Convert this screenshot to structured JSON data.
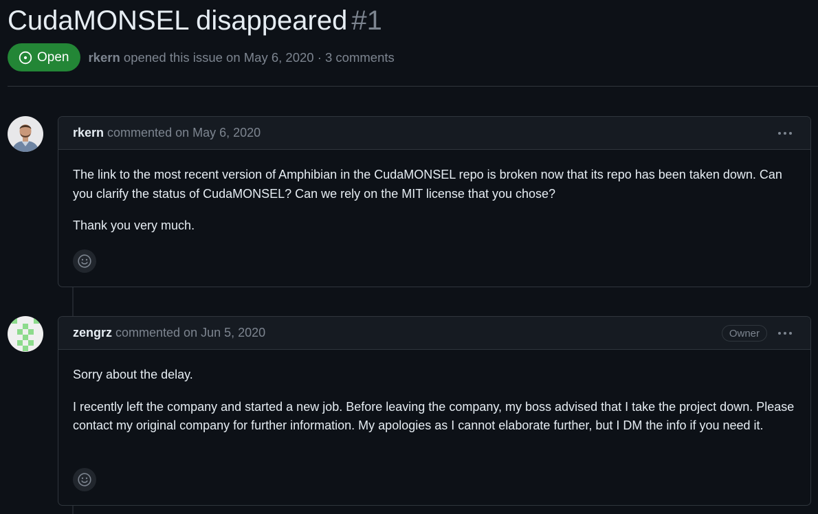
{
  "issue": {
    "title": "CudaMONSEL disappeared",
    "number": "#1",
    "state": "Open",
    "author": "rkern",
    "meta": "opened this issue on May 6, 2020 · 3 comments"
  },
  "comments": [
    {
      "author": "rkern",
      "date": "commented on May 6, 2020",
      "paragraphs": [
        "The link to the most recent version of Amphibian in the CudaMONSEL repo is broken now that its repo has been taken down. Can you clarify the status of CudaMONSEL? Can we rely on the MIT license that you chose?",
        "Thank you very much."
      ]
    },
    {
      "author": "zengrz",
      "date": "commented on Jun 5, 2020",
      "badge": "Owner",
      "paragraphs": [
        "Sorry about the delay.",
        "I recently left the company and started a new job. Before leaving the company, my boss advised that I take the project down. Please contact my original company for further information. My apologies as I cannot elaborate further, but I DM the info if you need it."
      ]
    }
  ],
  "icons": {
    "state": "issue-opened-icon",
    "menu": "kebab-horizontal-icon",
    "reaction": "smiley-icon"
  },
  "colors": {
    "background": "#0d1117",
    "open_badge": "#238636",
    "identicon": "#8ddb8c"
  }
}
